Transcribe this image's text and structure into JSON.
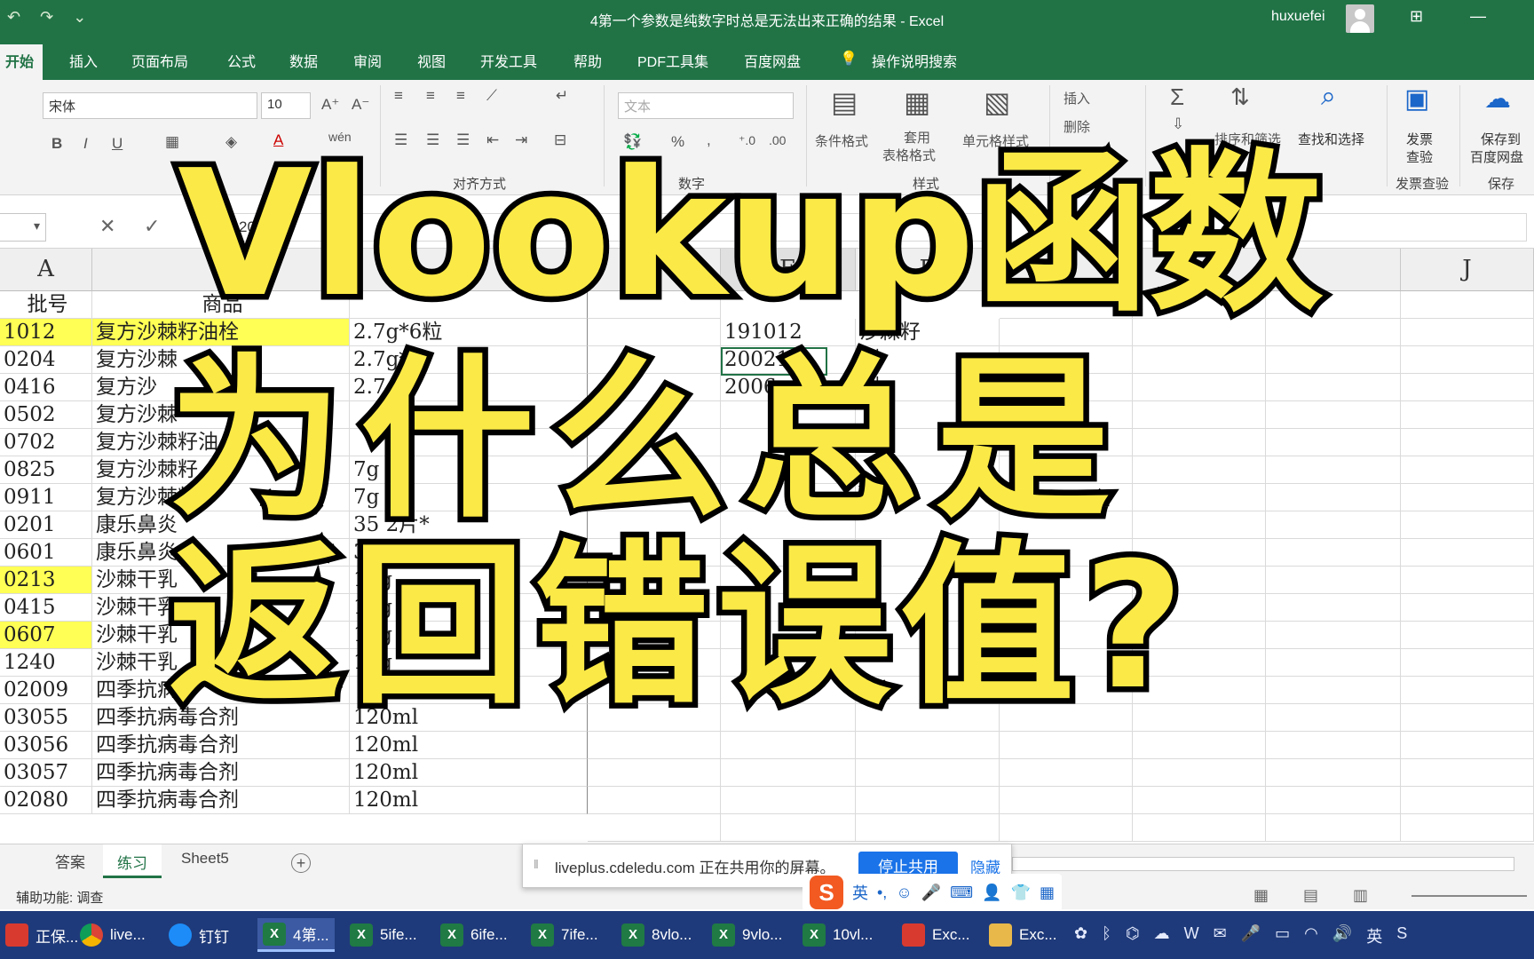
{
  "titlebar": {
    "doc_title": "4第一个参数是纯数字时总是无法出来正确的结果  -  Excel",
    "user": "huxuefei",
    "undo_icon": "undo-icon",
    "redo_icon": "redo-icon",
    "customize_icon": "chevron-down-icon"
  },
  "tabs": [
    "开始",
    "插入",
    "页面布局",
    "公式",
    "数据",
    "审阅",
    "视图",
    "开发工具",
    "帮助",
    "PDF工具集",
    "百度网盘",
    "操作说明搜索"
  ],
  "ribbon": {
    "font_name": "宋体",
    "font_size": "10",
    "number_format": "文本",
    "bold": "B",
    "italic": "I",
    "underline": "U",
    "wen": "wén",
    "pct": "%",
    "comma": ",",
    "cond_format": "条件格式",
    "table_format_1": "套用",
    "table_format_2": "表格格式",
    "cell_style": "单元格样式",
    "insert": "插入",
    "delete": "删除",
    "sort_filter": "排序和筛选",
    "find_select": "查找和选择",
    "invoice_1": "发票",
    "invoice_2": "查验",
    "save_baidu_1": "保存到",
    "save_baidu_2": "百度网盘",
    "group_align": "对齐方式",
    "group_number": "数字",
    "group_style": "样式",
    "group_invoice": "发票查验",
    "group_save": "保存"
  },
  "formula": {
    "cancel": "✕",
    "enter": "✓",
    "value": "20"
  },
  "grid": {
    "col_a": "A",
    "col_e": "E",
    "col_f": "F",
    "col_j": "J",
    "header_a": "批号",
    "header_b": "商品",
    "col_a_values": [
      "1012",
      "0204",
      "0416",
      "0502",
      "0702",
      "0825",
      "0911",
      "0201",
      "0601",
      "0213",
      "0415",
      "0607",
      "1240",
      "02009",
      "03055",
      "03056",
      "03057",
      "02080"
    ],
    "col_b_values": [
      "复方沙棘籽油栓",
      "复方沙棘",
      "复方沙",
      "复方沙棘",
      "复方沙棘籽油",
      "复方沙棘籽",
      "复方沙棘籽",
      "康乐鼻炎",
      "康乐鼻炎",
      "沙棘干乳",
      "沙棘干乳",
      "沙棘干乳",
      "沙棘干乳",
      "四季抗病",
      "四季抗病毒合剂",
      "四季抗病毒合剂",
      "四季抗病毒合剂",
      "四季抗病毒合剂"
    ],
    "col_c_values": [
      "2.7g*6粒",
      "2.7g*",
      "2.7g",
      "",
      "",
      "7g",
      "7g",
      "35 2片*",
      "3",
      "10g",
      "10g",
      "10g",
      "10g",
      "",
      "120ml",
      "120ml",
      "120ml",
      "120ml"
    ],
    "col_e_values": [
      "191012",
      "200213",
      "2006"
    ],
    "col_f_values": [
      "沙棘籽",
      "剂",
      "剂"
    ]
  },
  "sheets": [
    "答案",
    "练习",
    "Sheet5"
  ],
  "share": {
    "message": "liveplus.cdeledu.com 正在共用你的屏幕。",
    "stop": "停止共用",
    "hide": "隐藏"
  },
  "status": {
    "accessibility": "辅助功能: 调查"
  },
  "ime": {
    "lang": "英"
  },
  "taskbar": [
    {
      "label": "正保...",
      "icon": "red"
    },
    {
      "label": "live...",
      "icon": "chrome"
    },
    {
      "label": "钉钉",
      "icon": "ding"
    },
    {
      "label": "4第...",
      "icon": "xl"
    },
    {
      "label": "5ife...",
      "icon": "xl"
    },
    {
      "label": "6ife...",
      "icon": "xl"
    },
    {
      "label": "7ife...",
      "icon": "xl"
    },
    {
      "label": "8vlo...",
      "icon": "xl"
    },
    {
      "label": "9vlo...",
      "icon": "xl"
    },
    {
      "label": "10vl...",
      "icon": "xl"
    },
    {
      "label": "Exc...",
      "icon": "red"
    },
    {
      "label": "Exc...",
      "icon": "folder"
    }
  ],
  "tray_lang": "英",
  "overlay": {
    "line1": "Vlookup函数",
    "line2": "为什么总是",
    "line3": "返回错误值?"
  },
  "colors": {
    "excel_green": "#217346",
    "highlight_yellow": "#ffff55",
    "overlay_yellow": "#fbe947"
  }
}
